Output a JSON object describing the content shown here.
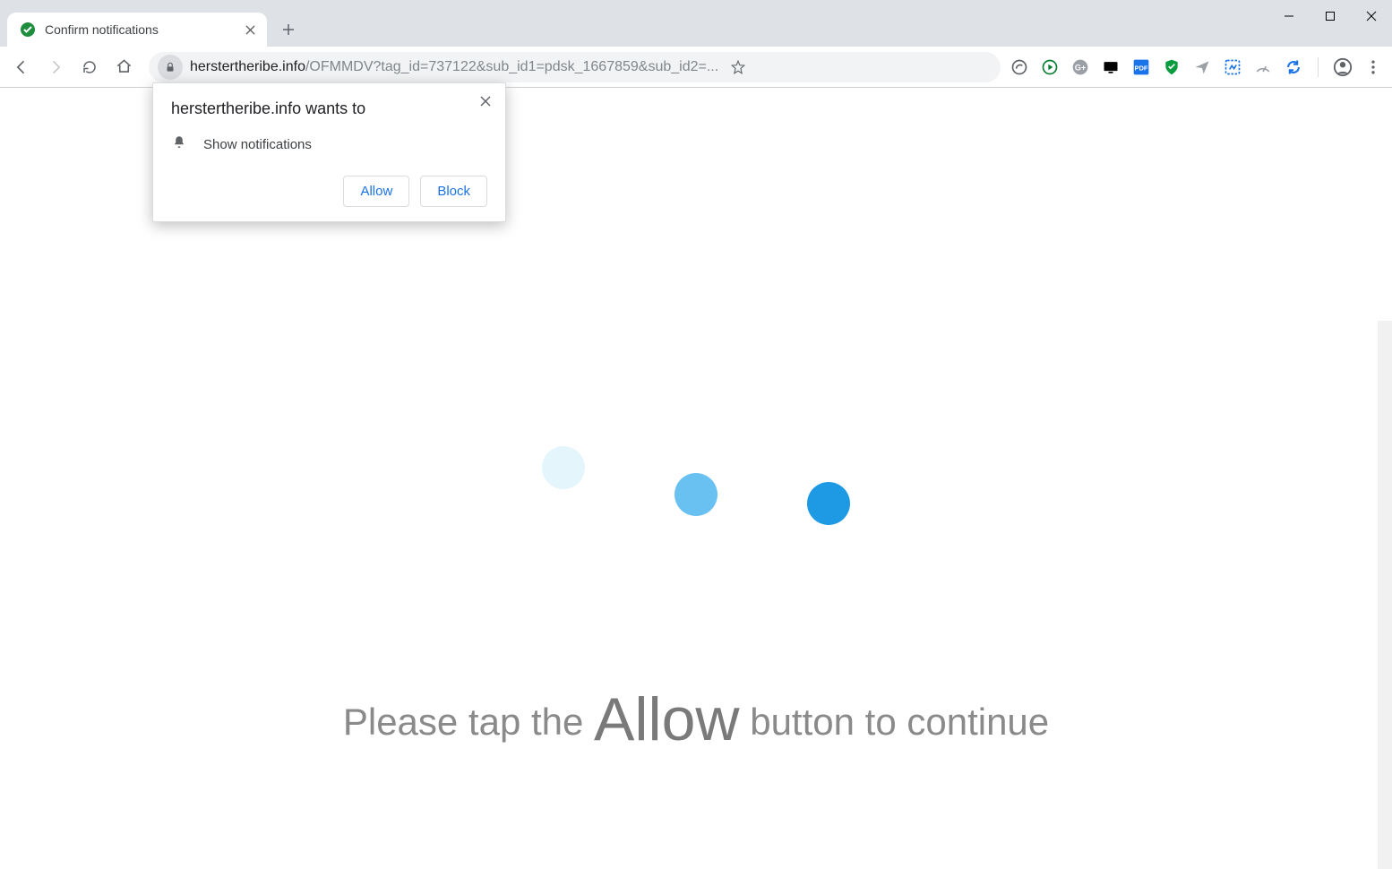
{
  "window": {
    "title": "Confirm notifications"
  },
  "tabs": [
    {
      "title": "Confirm notifications",
      "favicon": "check-circle"
    }
  ],
  "toolbar": {
    "url_host": "herstertheribe.info",
    "url_path": "/OFMMDV?tag_id=737122&sub_id1=pdsk_1667859&sub_id2=..."
  },
  "extensions": [
    {
      "name": "ext-dashlane",
      "icon": "circle-arrow",
      "color": "#5f6368"
    },
    {
      "name": "ext-play",
      "icon": "play-circle",
      "color": "#0a7d33"
    },
    {
      "name": "ext-gplus",
      "icon": "gplus",
      "color": "#8a8a8a"
    },
    {
      "name": "ext-screen",
      "icon": "monitor",
      "color": "#000"
    },
    {
      "name": "ext-pdf",
      "label": "PDF",
      "color": "#1a73e8"
    },
    {
      "name": "ext-shield",
      "icon": "shield",
      "color": "#0a9d3f"
    },
    {
      "name": "ext-paperplane",
      "icon": "paperplane",
      "color": "#9aa0a6"
    },
    {
      "name": "ext-clip",
      "icon": "clip",
      "color": "#1a73e8"
    },
    {
      "name": "ext-speed",
      "icon": "gauge",
      "color": "#9aa0a6"
    },
    {
      "name": "ext-sync",
      "icon": "sync",
      "color": "#1a73e8"
    }
  ],
  "permission_prompt": {
    "title": "herstertheribe.info wants to",
    "request": "Show notifications",
    "allow": "Allow",
    "block": "Block"
  },
  "page": {
    "cta_before": "Please tap the ",
    "cta_emph": "Allow",
    "cta_after": " button to continue"
  }
}
